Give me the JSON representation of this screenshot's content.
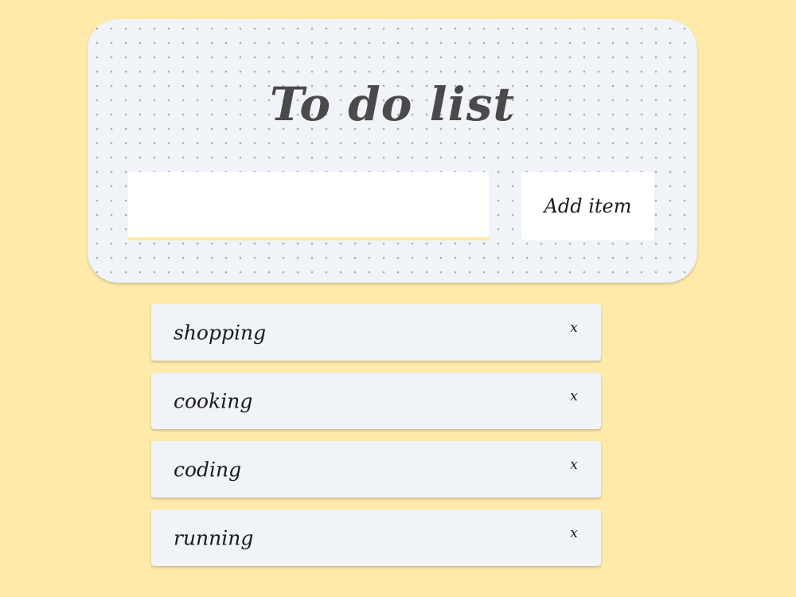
{
  "header": {
    "title": "To do list"
  },
  "form": {
    "input_value": "",
    "add_label": "Add item"
  },
  "todos": [
    {
      "label": "shopping",
      "delete_label": "x"
    },
    {
      "label": "cooking",
      "delete_label": "x"
    },
    {
      "label": "coding",
      "delete_label": "x"
    },
    {
      "label": "running",
      "delete_label": "x"
    }
  ],
  "colors": {
    "page_background": "#ffeaaa",
    "card_background": "#f0f3f7",
    "input_underline": "#ffe9a3",
    "title_text": "#4a4a4a"
  }
}
